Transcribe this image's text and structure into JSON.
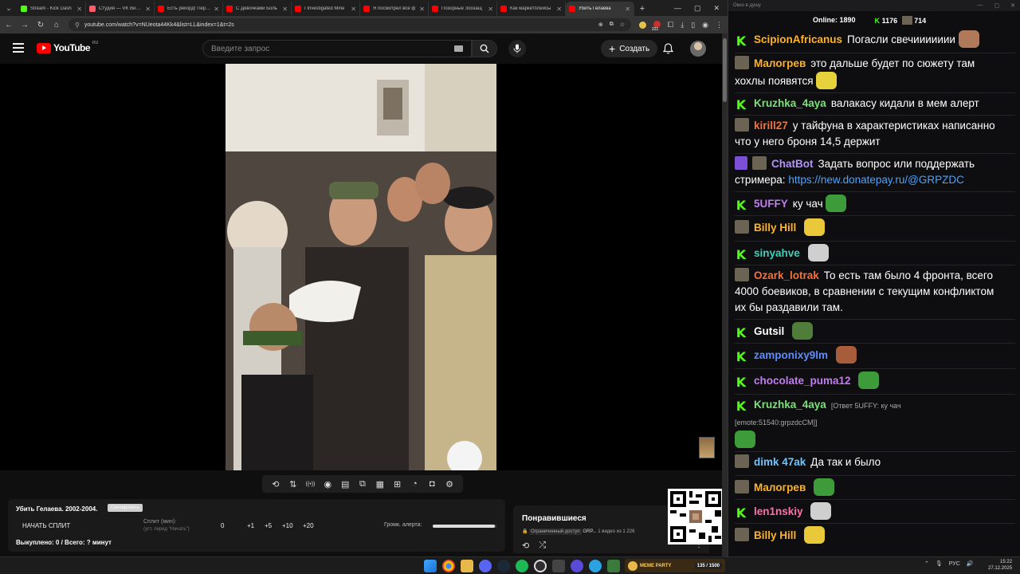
{
  "browser": {
    "tabs": [
      {
        "title": "Stream - Kick Dash",
        "color": "#53fc18"
      },
      {
        "title": "Студия — VK Видео",
        "color": "#ff5b6b"
      },
      {
        "title": "Есть рекорд! Перев",
        "color": "#ff0000"
      },
      {
        "title": "С Девочками Боль",
        "color": "#ff0000"
      },
      {
        "title": "I Investigated Mine",
        "color": "#ff0000"
      },
      {
        "title": "Я посмотрел все ф",
        "color": "#ff0000"
      },
      {
        "title": "Позорные Зоозащ",
        "color": "#ff0000"
      },
      {
        "title": "Как маркетплейсы",
        "color": "#ff0000"
      },
      {
        "title": "Убить Гелаева",
        "color": "#ff0000"
      }
    ],
    "new_tab": "+",
    "url": "youtube.com/watch?v=NUeota44Kk4&list=LL&index=1&t=2s",
    "ext_count": "221"
  },
  "youtube": {
    "logo_text": "YouTube",
    "country": "RU",
    "search_placeholder": "Введите запрос",
    "create_label": "Создать"
  },
  "toolbar_icons": [
    "loop-icon",
    "sort-icon",
    "radio-icon",
    "eye-icon",
    "film-icon",
    "pip-icon",
    "frames-icon",
    "add-frame-icon",
    "speed-icon",
    "camera-icon",
    "settings-icon"
  ],
  "split": {
    "title": "Убить Гелаева. 2002-2004.",
    "tag": "Скопировать",
    "start_label": "НАЧАТЬ СПЛИТ",
    "split_label": "Сплит (мин):",
    "split_hint": "(уст. перед \"Начать\")",
    "split_value": "0",
    "increments": [
      "+1",
      "+5",
      "+10",
      "+20"
    ],
    "alert_label": "Громк. алерта:",
    "alert_volume": 0.98,
    "bought": "Выкуплено: 0 / Всего: ? минут"
  },
  "liked": {
    "title": "Понравившиеся",
    "access": "Ограниченный доступ",
    "owner": "GRP...",
    "count": "1 видео из 1 226"
  },
  "chat": {
    "window_title": "Окно в душу",
    "online_label": "Online:",
    "online": "1890",
    "followers": "1176",
    "subs": "714",
    "messages": [
      {
        "platform": "kick",
        "user": "ScipionAfricanus",
        "color": "#ffb224",
        "text": "Погасли свечиииииии",
        "emote": "#b07a5a"
      },
      {
        "platform": "vk",
        "user": "Малогрев",
        "color": "#ffb224",
        "text": "это дальше будет по сюжету там хохлы появятся",
        "emote": "#e6d23a"
      },
      {
        "platform": "kick",
        "user": "Kruzhka_4aya",
        "color": "#7ce079",
        "text": "валакасу кидали в мем алерт"
      },
      {
        "platform": "vk",
        "user": "kirill27",
        "color": "#f0733c",
        "text": "у тайфуна в характеристиках написанно что у него броня 14,5 держит"
      },
      {
        "platform": "bot",
        "user": "ChatBot",
        "color": "#b592ff",
        "text": "Задать вопрос или поддержать стримера:",
        "link": "https://new.donatepay.ru/@GRPZDC"
      },
      {
        "platform": "kick",
        "user": "5UFFY",
        "color": "#c27cf2",
        "text": "ку чач",
        "emote": "#3e9b3a"
      },
      {
        "platform": "vk",
        "user": "Billy Hill",
        "color": "#ffb224",
        "text": "",
        "emote": "#e9c83a"
      },
      {
        "platform": "kick",
        "user": "sinyahve",
        "color": "#3fcfb8",
        "text": "",
        "emote": "#cfcfcf"
      },
      {
        "platform": "vk",
        "user": "Ozark_lotrak",
        "color": "#f0733c",
        "text": "То есть там было 4 фронта, всего 4000 боевиков, в сравнении с текущим конфликтом их бы раздавили там."
      },
      {
        "platform": "kick",
        "user": "Gutsil",
        "color": "#ffffff",
        "text": "",
        "emote": "#4f7d3a"
      },
      {
        "platform": "kick",
        "user": "zamponixy9lm",
        "color": "#5b8cff",
        "text": "",
        "emote": "#a85d3a"
      },
      {
        "platform": "kick",
        "user": "chocolate_puma12",
        "color": "#c27cf2",
        "text": "",
        "emote": "#3e9b3a"
      },
      {
        "platform": "kick",
        "user": "Kruzhka_4aya",
        "color": "#7ce079",
        "reply": "[Ответ 5UFFY: ку чач",
        "text": "[emote:51540:grpzdcCM]]",
        "emote": "#3e9b3a"
      },
      {
        "platform": "vk",
        "user": "dimk 47ak",
        "color": "#6fc3ff",
        "text": "Да так и было"
      },
      {
        "platform": "vk",
        "user": "Малогрев",
        "color": "#ffb224",
        "text": "",
        "emote": "#3e9b3a"
      },
      {
        "platform": "kick",
        "user": "len1nskiy",
        "color": "#ff6fa8",
        "text": "",
        "emote": "#cfcfcf"
      },
      {
        "platform": "vk",
        "user": "Billy Hill",
        "color": "#ffb224",
        "text": "",
        "emote": "#e9c83a"
      }
    ]
  },
  "taskbar": {
    "widget_label": "MEME PARTY",
    "widget_progress": "135 / 1500",
    "lang": "РУС",
    "time": "15:22",
    "date": "27.12.2025"
  }
}
